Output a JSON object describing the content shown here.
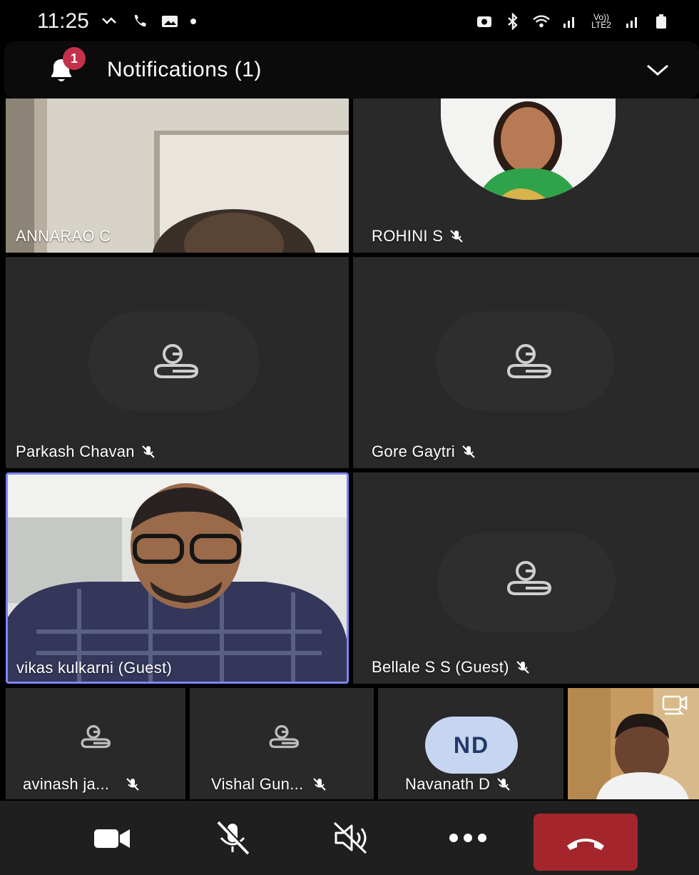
{
  "status_bar": {
    "time": "11:25",
    "signal_label": "Vo)) LTE2"
  },
  "notification": {
    "title": "Notifications (1)",
    "badge_count": "1"
  },
  "participants": [
    {
      "name": "ANNARAO C",
      "muted": false,
      "video": true
    },
    {
      "name": "ROHINI S",
      "muted": true,
      "video": false,
      "photo": true
    },
    {
      "name": "Parkash Chavan",
      "muted": true,
      "video": false
    },
    {
      "name": "Gore Gaytri",
      "muted": true,
      "video": false
    },
    {
      "name": "vikas kulkarni (Guest)",
      "muted": false,
      "video": true,
      "active_speaker": true
    },
    {
      "name": "Bellale S S (Guest)",
      "muted": true,
      "video": false
    },
    {
      "name": "avinash ja...",
      "muted": true,
      "video": false
    },
    {
      "name": "Vishal Gun...",
      "muted": true,
      "video": false
    },
    {
      "name": "Navanath D",
      "muted": true,
      "video": false,
      "initials": "ND"
    }
  ],
  "colors": {
    "tile_bg": "#292929",
    "active_border": "#7f85f5",
    "hangup": "#a4262c",
    "badge": "#c4314b",
    "avatar_bg": "#c7d6f0"
  },
  "controls": {
    "camera_icon": "video-camera-icon",
    "mic_icon": "mic-off-icon",
    "speaker_icon": "speaker-off-icon",
    "more_icon": "more-dots-icon",
    "hangup_icon": "phone-hangup-icon"
  }
}
